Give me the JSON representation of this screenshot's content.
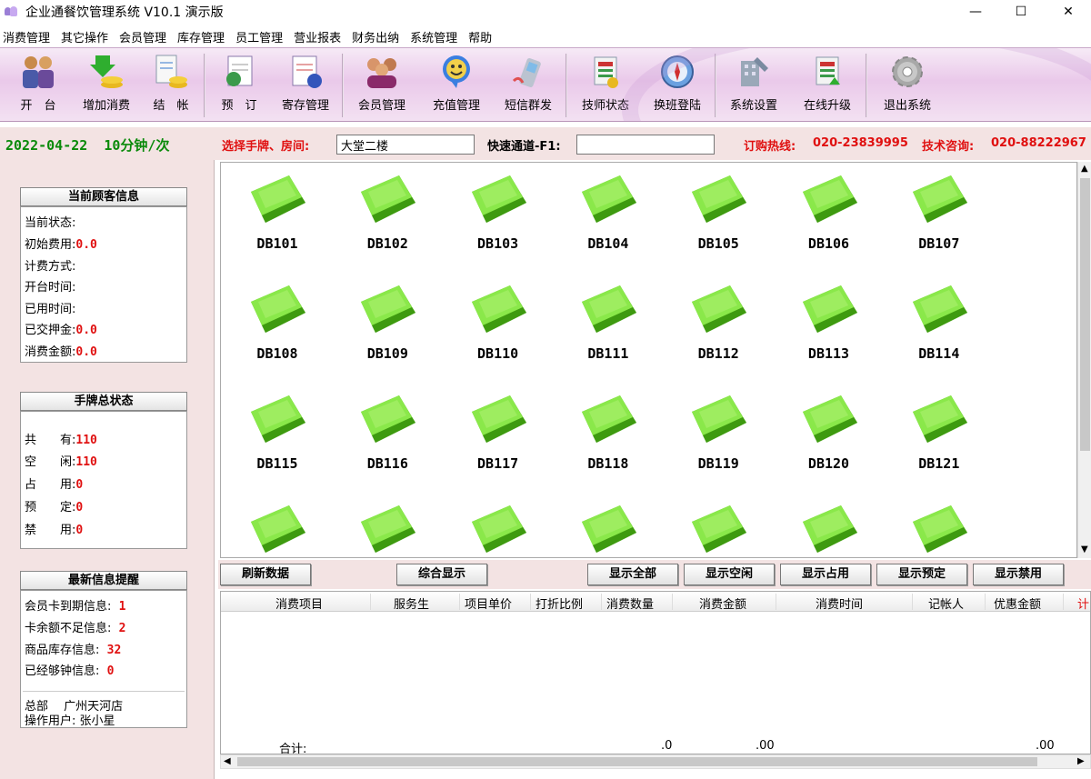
{
  "window": {
    "title": "企业通餐饮管理系统 V10.1  演示版",
    "minimize": "—",
    "maximize": "☐",
    "close": "✕"
  },
  "menu": [
    "消费管理",
    "其它操作",
    "会员管理",
    "库存管理",
    "员工管理",
    "营业报表",
    "财务出纳",
    "系统管理",
    "帮助"
  ],
  "toolbar": [
    {
      "label": "开　台",
      "icon": "people-icon"
    },
    {
      "label": "增加消费",
      "icon": "coins-arrow-icon"
    },
    {
      "label": "结　帐",
      "icon": "receipt-coins-icon"
    },
    {
      "label": "预　订",
      "icon": "booking-icon"
    },
    {
      "label": "寄存管理",
      "icon": "storage-icon"
    },
    {
      "label": "会员管理",
      "icon": "members-icon"
    },
    {
      "label": "充值管理",
      "icon": "smiley-icon"
    },
    {
      "label": "短信群发",
      "icon": "phone-icon"
    },
    {
      "label": "技师状态",
      "icon": "tech-status-icon"
    },
    {
      "label": "换班登陆",
      "icon": "compass-icon"
    },
    {
      "label": "系统设置",
      "icon": "settings-icon"
    },
    {
      "label": "在线升级",
      "icon": "upgrade-icon"
    },
    {
      "label": "退出系统",
      "icon": "gear-icon"
    }
  ],
  "status": {
    "date": "2022-04-22",
    "rate": "10分钟/次",
    "select_label": "选择手牌、房间:",
    "select_value": "大堂二楼",
    "quick_label": "快速通道-F1:",
    "quick_value": "",
    "hotline_label": "订购热线:",
    "hotline": "020-23839995",
    "support_label": "技术咨询:",
    "support": "020-88222967"
  },
  "customer_panel": {
    "title": "当前顾客信息",
    "rows": [
      {
        "label": "当前状态:",
        "value": ""
      },
      {
        "label": "初始费用:",
        "value": "0.0"
      },
      {
        "label": "计费方式:",
        "value": ""
      },
      {
        "label": "开台时间:",
        "value": ""
      },
      {
        "label": "已用时间:",
        "value": ""
      },
      {
        "label": "已交押金:",
        "value": "0.0"
      },
      {
        "label": "消费金额:",
        "value": "0.0"
      }
    ]
  },
  "status_panel": {
    "title": "手牌总状态",
    "rows": [
      {
        "label": "共　　有:",
        "value": "110"
      },
      {
        "label": "空　　闲:",
        "value": "110"
      },
      {
        "label": "占　　用:",
        "value": "0"
      },
      {
        "label": "预　　定:",
        "value": "0"
      },
      {
        "label": "禁　　用:",
        "value": "0"
      }
    ]
  },
  "info_panel": {
    "title": "最新信息提醒",
    "rows": [
      {
        "label": "会员卡到期信息:",
        "value": "1"
      },
      {
        "label": "卡余额不足信息:",
        "value": "2"
      },
      {
        "label": "商品库存信息:",
        "value": "32"
      },
      {
        "label": "已经够钟信息:",
        "value": "0"
      }
    ],
    "branch": "总部　 广州天河店",
    "user": "操作用户: 张小星"
  },
  "rooms": [
    "DB101",
    "DB102",
    "DB103",
    "DB104",
    "DB105",
    "DB106",
    "DB107",
    "DB108",
    "DB109",
    "DB110",
    "DB111",
    "DB112",
    "DB113",
    "DB114",
    "DB115",
    "DB116",
    "DB117",
    "DB118",
    "DB119",
    "DB120",
    "DB121",
    "",
    "",
    "",
    "",
    "",
    "",
    ""
  ],
  "buttons": {
    "refresh": "刷新数据",
    "combined": "综合显示",
    "all": "显示全部",
    "free": "显示空闲",
    "used": "显示占用",
    "reserved": "显示预定",
    "disabled": "显示禁用"
  },
  "table": {
    "columns": [
      "消费项目",
      "服务生",
      "项目单价",
      "打折比例",
      "消费数量",
      "消费金额",
      "消费时间",
      "记帐人",
      "优惠金额",
      "计"
    ],
    "total_label": "合计:",
    "total_qty": ".0",
    "total_amount": ".00",
    "total_discount": ".00"
  },
  "colors": {
    "accent_red": "#e01010",
    "date_green": "#0a8a0a",
    "room_green": "#6fd42a",
    "toolbar_purple": "#eac9ea"
  }
}
